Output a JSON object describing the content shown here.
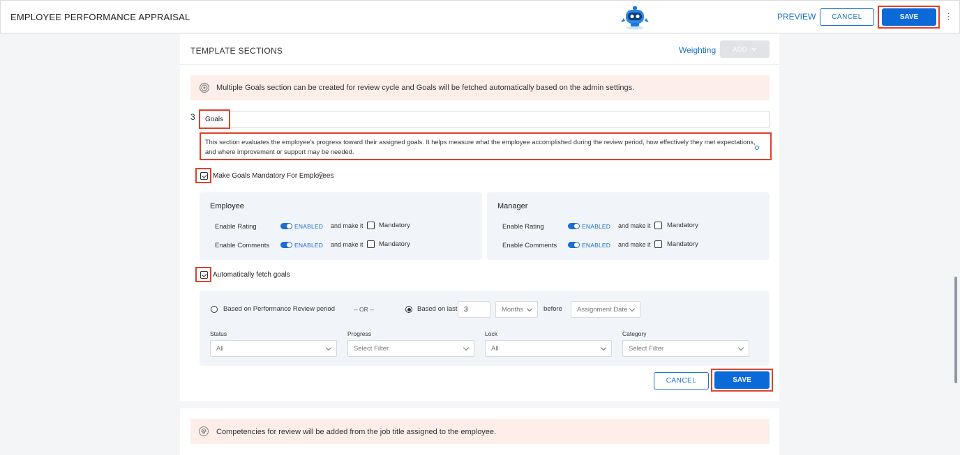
{
  "header": {
    "title": "EMPLOYEE PERFORMANCE APPRAISAL",
    "preview_label": "PREVIEW",
    "cancel_label": "CANCEL",
    "save_label": "SAVE",
    "more_icon": "vertical-ellipsis-icon"
  },
  "sections": {
    "title": "TEMPLATE SECTIONS",
    "weighting_label": "Weighting",
    "add_label": "ADD"
  },
  "goals_info": {
    "text": "Multiple Goals section can be created for review cycle and Goals will be fetched automatically based on the admin settings.",
    "icon": "target-icon"
  },
  "goal_section": {
    "number": "3",
    "title_value": "Goals",
    "description": "This section evaluates the employee's progress toward their assigned goals. It helps measure what the employee accomplished during the review period, how effectively they met expectations, and where improvement or support may be needed.",
    "mandatory_label": "Make Goals Mandatory For Employees",
    "mandatory_checked": true,
    "auto_fetch_label": "Automatically fetch goals",
    "auto_fetch_checked": true
  },
  "employee": {
    "title": "Employee",
    "rating_label": "Enable Rating",
    "comments_label": "Enable Comments",
    "enabled_text": "ENABLED",
    "make_it_text": "and make it",
    "mandatory_text": "Mandatory"
  },
  "manager": {
    "title": "Manager",
    "rating_label": "Enable Rating",
    "comments_label": "Enable Comments",
    "enabled_text": "ENABLED",
    "make_it_text": "and make it",
    "mandatory_text": "Mandatory"
  },
  "fetch": {
    "option_period": "Based on Performance Review period",
    "or_text": "-- OR --",
    "option_last": "Based on last",
    "last_value": "3",
    "unit_value": "Months",
    "before_text": "before",
    "date_value": "Assignment Date"
  },
  "filters": {
    "status_label": "Status",
    "status_value": "All",
    "progress_label": "Progress",
    "progress_value": "Select Filter",
    "lock_label": "Lock",
    "lock_value": "All",
    "category_label": "Category",
    "category_value": "Select Filter"
  },
  "footer": {
    "cancel_label": "CANCEL",
    "save_label": "SAVE"
  },
  "competencies_info": {
    "text": "Competencies for review will be added from the job title assigned to the employee.",
    "icon": "fingerprint-icon"
  },
  "colors": {
    "accent": "#0c6ad8",
    "highlight": "#e0412a",
    "info_bg": "#fdeeea"
  }
}
